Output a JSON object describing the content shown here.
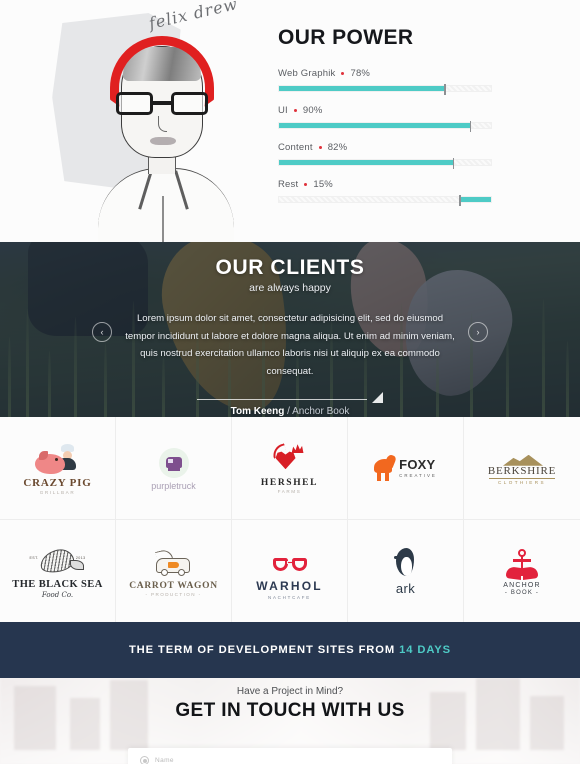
{
  "hero": {
    "signature": "felix drew",
    "portrait_alt": "illustrated-portrait-man-with-glasses-and-red-headband",
    "power": {
      "title": "OUR POWER",
      "skills": [
        {
          "name": "Web Graphik",
          "percent": "78%",
          "value": 78,
          "inverted": false
        },
        {
          "name": "UI",
          "percent": "90%",
          "value": 90,
          "inverted": false
        },
        {
          "name": "Content",
          "percent": "82%",
          "value": 82,
          "inverted": false
        },
        {
          "name": "Rest",
          "percent": "15%",
          "value": 15,
          "inverted": true
        }
      ],
      "bar_color": "#4ecbc6",
      "dot_color": "#e0323c"
    }
  },
  "clients": {
    "title": "OUR CLIENTS",
    "subtitle": "are always happy",
    "quote": "Lorem ipsum dolor sit amet, consectetur adipisicing elit, sed do eiusmod tempor incididunt ut labore et dolore magna aliqua. Ut enim ad minim veniam, quis nostrud exercitation ullamco laboris nisi ut aliquip ex ea commodo consequat.",
    "author_name": "Tom Keeng",
    "author_separator": " / ",
    "author_company": "Anchor Book",
    "prev_arrow": "‹",
    "next_arrow": "›"
  },
  "logos": [
    {
      "name": "CRAZY PIG",
      "tagline": "GRILLBAR",
      "mark": "pig-chef-icon"
    },
    {
      "name": "purpletruck",
      "tagline": "",
      "mark": "purple-truck-icon"
    },
    {
      "name": "HERSHEL",
      "tagline": "FARMS",
      "mark": "rooster-heart-icon"
    },
    {
      "name": "FOXY",
      "tagline": "CREATIVE",
      "mark": "fox-icon"
    },
    {
      "name": "BERKSHIRE",
      "tagline": "CLOTHIERS",
      "mark": "mountain-icon"
    },
    {
      "name": "THE BLACK SEA",
      "tagline": "Food Co.",
      "mark": "shell-fish-icon"
    },
    {
      "name": "CARROT WAGON",
      "tagline": "- PRODUCTION -",
      "mark": "carrot-van-icon"
    },
    {
      "name": "WARHOL",
      "tagline": "NACHTCAFE",
      "mark": "glasses-icon"
    },
    {
      "name": "ark",
      "tagline": "",
      "mark": "penguin-icon"
    },
    {
      "name": "ANCHOR",
      "tagline": "- BOOK -",
      "mark": "anchor-book-icon"
    }
  ],
  "term_banner": {
    "text": "THE TERM OF DEVELOPMENT SITES FROM ",
    "highlight": "14 DAYS",
    "background": "#26364f",
    "highlight_color": "#4ecbc6"
  },
  "contact": {
    "subtitle": "Have a Project in Mind?",
    "title": "GET IN TOUCH WITH US",
    "form": {
      "name_label": "Name",
      "name_icon": "user-circle-icon"
    }
  }
}
